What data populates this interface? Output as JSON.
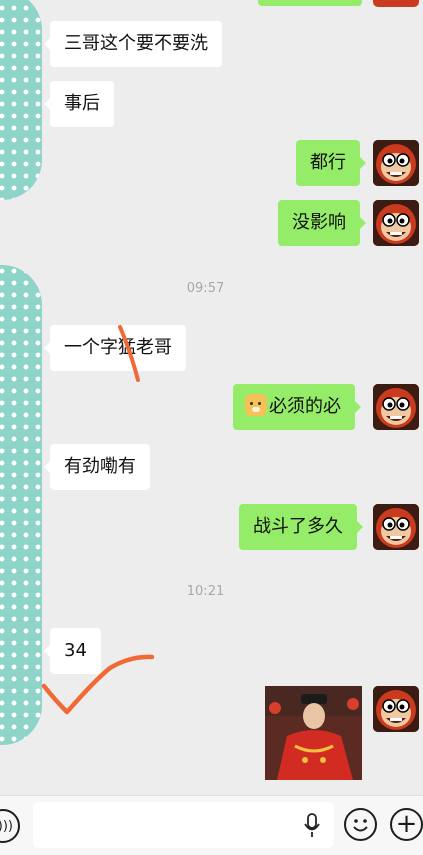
{
  "messages": [
    {
      "side": "in",
      "text": "三哥这个要不要洗"
    },
    {
      "side": "in",
      "text": "事后"
    },
    {
      "side": "out",
      "text": "都行"
    },
    {
      "side": "out",
      "text": "没影响"
    },
    {
      "type": "timestamp",
      "text": "09:57"
    },
    {
      "side": "in",
      "text": "一个字猛老哥"
    },
    {
      "side": "out",
      "text": "必须的必",
      "prefix_emoji": "dog-face-emoji"
    },
    {
      "side": "in",
      "text": "有劲嘞有"
    },
    {
      "side": "out",
      "text": "战斗了多久"
    },
    {
      "type": "timestamp",
      "text": "10:21"
    },
    {
      "side": "in",
      "text": "34"
    },
    {
      "side": "out",
      "type": "image",
      "description_icon": "gif-image"
    }
  ],
  "input_bar": {
    "voice_icon": "voice-icon",
    "placeholder": "",
    "mic_icon": "mic-icon",
    "emoji_icon": "emoji-icon",
    "plus_label": "+"
  },
  "colors": {
    "background": "#ededed",
    "incoming_bubble": "#ffffff",
    "outgoing_bubble": "#95ec69",
    "scribble": "#ef6a36",
    "other_avatar": "#8ed4c8"
  }
}
